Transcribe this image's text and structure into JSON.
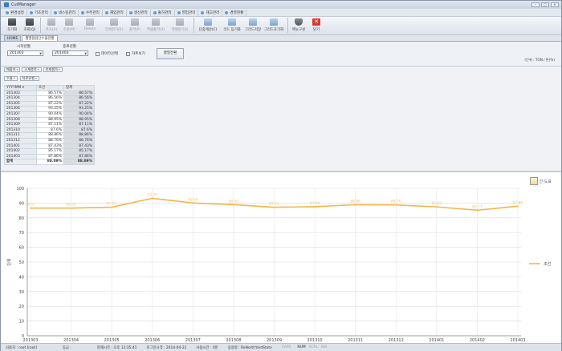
{
  "window": {
    "title": "CutManager"
  },
  "menu": [
    "환경설정",
    "기초관리",
    "네스팅관리",
    "수주관리",
    "재입관리",
    "생산관리",
    "출하관리",
    "영업관리",
    "재고관리",
    "경영현황"
  ],
  "toolbar": [
    {
      "label": "초기화",
      "icon": "reset-icon",
      "style": "dark",
      "enabled": true
    },
    {
      "label": "조회(Q)",
      "icon": "search-icon",
      "style": "dark",
      "enabled": true
    },
    {
      "label": "추가(A)",
      "icon": "add-icon",
      "style": "grey",
      "enabled": false
    },
    {
      "label": "수정(M)",
      "icon": "edit-icon",
      "style": "grey",
      "enabled": false
    },
    {
      "label": "Delete",
      "icon": "delete-icon",
      "style": "grey",
      "enabled": false
    },
    {
      "label": "전체열기(E)",
      "icon": "expand-icon",
      "style": "grey",
      "enabled": false
    },
    {
      "label": "출력(P)",
      "icon": "print-icon",
      "style": "grey",
      "enabled": false
    },
    {
      "label": "엑셀출력(X)",
      "icon": "excel-icon",
      "style": "grey",
      "enabled": false
    },
    {
      "label": "엑셀읽기(I)",
      "icon": "excel-import-icon",
      "style": "grey",
      "enabled": false
    },
    {
      "label": "단중계산(C)",
      "icon": "calculator-icon",
      "style": "blue",
      "enabled": true
    },
    {
      "label": "코드 등기화",
      "icon": "code-sync-icon",
      "style": "blue",
      "enabled": true
    },
    {
      "label": "그리드저장",
      "icon": "grid-save-icon",
      "style": "blue",
      "enabled": true
    },
    {
      "label": "그리드초기화",
      "icon": "grid-reset-icon",
      "style": "blue",
      "enabled": true
    },
    {
      "label": "메뉴구성",
      "icon": "menu-config-icon",
      "style": "shield",
      "enabled": true
    },
    {
      "label": "닫기",
      "icon": "close-icon",
      "style": "red",
      "enabled": true
    }
  ],
  "tabs": [
    {
      "label": "HOME",
      "active": false
    },
    {
      "label": "월별협압단수율현황",
      "active": true
    }
  ],
  "filters": {
    "start_label": "시작년월",
    "start_value": "201303",
    "end_label": "종료년월",
    "end_value": "201403",
    "data_select_label": "데이터선택",
    "chart_view_label": "차트보기",
    "chart_view_checked": true,
    "convert_button": "행열전환",
    "unit_text": "(단위 : TON / 톤(%)"
  },
  "group_fields": [
    "매출처",
    "소재품목",
    "부재품목"
  ],
  "pivot": {
    "row_field": "수율",
    "col_field": "자료유형",
    "col_header": "YYYYMM",
    "col1": "조선",
    "col2": "합계",
    "rows": [
      {
        "ym": "201303",
        "v1": "86.57%",
        "v2": "86.57%"
      },
      {
        "ym": "201304",
        "v1": "86.56%",
        "v2": "86.56%"
      },
      {
        "ym": "201305",
        "v1": "87.22%",
        "v2": "87.22%"
      },
      {
        "ym": "201306",
        "v1": "93.25%",
        "v2": "93.25%"
      },
      {
        "ym": "201307",
        "v1": "90.04%",
        "v2": "90.04%"
      },
      {
        "ym": "201308",
        "v1": "88.95%",
        "v2": "88.95%"
      },
      {
        "ym": "201309",
        "v1": "87.11%",
        "v2": "87.11%"
      },
      {
        "ym": "201310",
        "v1": "87.6%",
        "v2": "87.6%"
      },
      {
        "ym": "201311",
        "v1": "88.86%",
        "v2": "88.86%"
      },
      {
        "ym": "201312",
        "v1": "88.76%",
        "v2": "88.76%"
      },
      {
        "ym": "201401",
        "v1": "87.43%",
        "v2": "87.43%"
      },
      {
        "ym": "201402",
        "v1": "85.17%",
        "v2": "85.17%"
      },
      {
        "ym": "201403",
        "v1": "87.86%",
        "v2": "87.86%"
      }
    ],
    "total": {
      "ym": "합계",
      "v1": "88.09%",
      "v2": "88.09%"
    }
  },
  "chart_button_label": "선 도표",
  "chart_data": {
    "type": "line",
    "categories": [
      "201303",
      "201304",
      "201305",
      "201306",
      "201307",
      "201308",
      "201309",
      "201310",
      "201311",
      "201312",
      "201401",
      "201402",
      "201403"
    ],
    "series": [
      {
        "name": "조선",
        "values": [
          86.57,
          86.56,
          87.22,
          93.25,
          90.04,
          88.95,
          87.11,
          87.6,
          88.86,
          88.76,
          87.43,
          85.17,
          87.86
        ],
        "color": "#f5b54a"
      }
    ],
    "ylabel": "단위",
    "ylim": [
      0,
      100
    ],
    "yticks": [
      0,
      10,
      20,
      30,
      40,
      50,
      60,
      70,
      80,
      90,
      100
    ],
    "grid": true,
    "legend": "right"
  },
  "status": {
    "user": "사용자 : root [root]",
    "level": "등급 :",
    "current_time": "현재시각 : 오후 12:35:41",
    "login_time": "로그인시각 : 2014-04-22",
    "usage": "사용시간 : 0분",
    "path": "응용정 : ReNorthYardState",
    "caps": "CAPS",
    "num": "NUM",
    "scrl": "SCRL",
    "ins": "INS"
  }
}
